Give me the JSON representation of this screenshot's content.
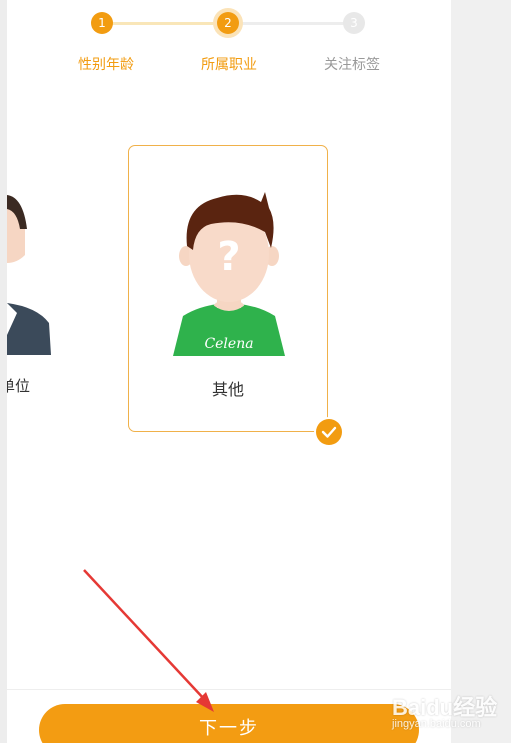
{
  "stepper": {
    "steps": [
      {
        "number": "1",
        "label": "性别年龄",
        "state": "done"
      },
      {
        "number": "2",
        "label": "所属职业",
        "state": "current"
      },
      {
        "number": "3",
        "label": "关注标签",
        "state": "todo"
      }
    ]
  },
  "occupations": {
    "partial_label": "单位",
    "selected_label": "其他"
  },
  "avatar": {
    "shirt_text": "Celena",
    "face_mark": "?"
  },
  "actions": {
    "next_label": "下一步"
  },
  "watermark": {
    "brand": "Baidu经验",
    "sub": "jingyan.baidu.com"
  },
  "colors": {
    "accent": "#f29c11",
    "card_border": "#f0b14a",
    "arrow": "#e53935"
  }
}
